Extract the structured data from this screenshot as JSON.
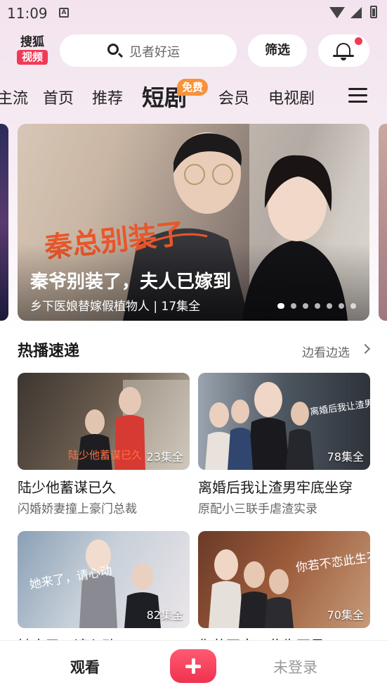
{
  "status_bar": {
    "time": "11:09",
    "notification_icon": "a-icon"
  },
  "header": {
    "logo_top": "搜狐",
    "logo_bottom": "视频",
    "search_placeholder": "见者好运",
    "filter_label": "筛选",
    "bell_icon": "bell-icon",
    "notification_dot": true
  },
  "tabs": [
    {
      "label": "主流"
    },
    {
      "label": "首页"
    },
    {
      "label": "推荐"
    },
    {
      "label": "短剧",
      "active": true,
      "badge": "免费"
    },
    {
      "label": "会员"
    },
    {
      "label": "电视剧"
    }
  ],
  "banner": {
    "title": "秦爷别装了，夫人已嫁到",
    "subtitle": "乡下医娘替嫁假植物人 | 17集全",
    "artwork_text": "秦总别装了",
    "slides": 7,
    "active_slide": 0
  },
  "section": {
    "title": "热播速递",
    "more_label": "边看边选"
  },
  "cards": [
    {
      "title": "陆少他蓄谋已久",
      "subtitle": "闪婚娇妻撞上豪门总裁",
      "episodes": "23集全",
      "poster_text": "陆少他蓄谋已久"
    },
    {
      "title": "离婚后我让渣男牢底坐穿",
      "subtitle": "原配小三联手虐渣实录",
      "episodes": "78集全",
      "poster_text": "离婚后我让渣男牢底坐穿"
    },
    {
      "title": "她来了，请心动",
      "subtitle": "",
      "episodes": "82集全",
      "poster_text": "她来了，请心动"
    },
    {
      "title": "你若不恋，此生不见",
      "subtitle": "",
      "episodes": "70集全",
      "poster_text": "你若不恋此生不见"
    }
  ],
  "bottom_nav": {
    "watch_label": "观看",
    "login_label": "未登录"
  },
  "colors": {
    "accent": "#f03a55",
    "badge": "#f7923a",
    "header_gradient_top": "#f3e3ee"
  }
}
